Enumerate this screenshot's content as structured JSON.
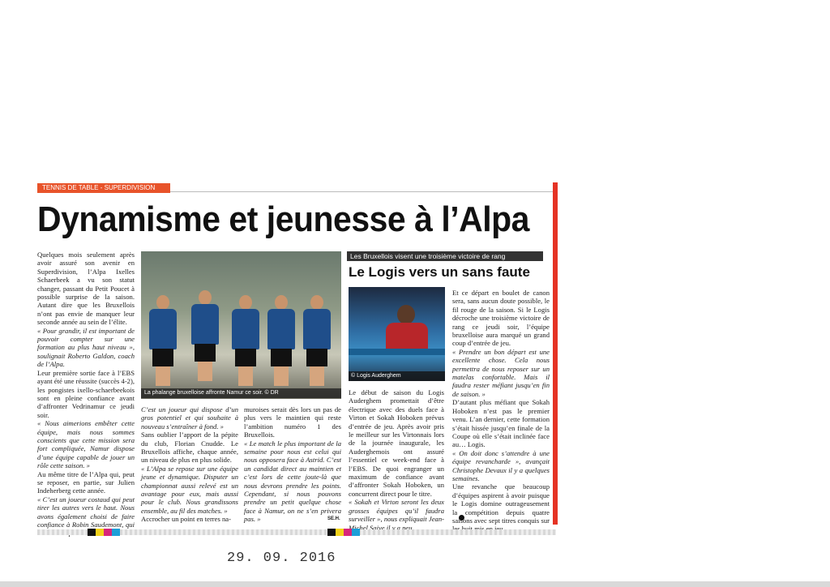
{
  "article": {
    "kicker": "TENNIS DE TABLE - SUPERDIVISION",
    "headline": "Dynamisme et jeunesse à l’Alpa",
    "col1": [
      "Quelques mois seulement après avoir assuré son avenir en Superdivision, l’Alpa Ixelles Schaerbeek a vu son statut changer, passant du Petit Poucet à possible surprise de la saison. Autant dire que les Bruxellois n’ont pas envie de manquer leur seconde année au sein de l’élite.",
      "« Pour grandir, il est important de pouvoir compter sur une formation au plus haut niveau », soulignait Roberto Galdon, coach de l’Alpa.",
      "Leur première sortie face à l’EBS ayant été une réussite (succès 4-2), les pongistes ixello-schaerbeekois sont en pleine confiance avant d’affronter Vedrinamur ce jeudi soir.",
      "« Nous aimerions embêter cette équipe, mais nous sommes conscients que cette mission sera fort compliquée, Namur dispose d’une équipe capable de jouer un rôle cette saison. »",
      "Au même titre de l’Alpa qui, peut se reposer, en partie, sur Julien Indeherberg cette année.",
      "« C’est un joueur costaud qui peut tirer les autres vers le haut. Nous avons également choisi de faire confiance à Robin Saudemont, qui retrouve le plus haut niveau."
    ],
    "col2": [
      "C’est un joueur qui dispose d’un gros potentiel et qui souhaite à nouveau s’entraîner à fond. »",
      "Sans oublier l’apport de la pépite du club, Florian Cnudde. Le Bruxellois affiche, chaque année, un niveau de plus en plus solide.",
      "« L’Alpa se repose sur une équipe jeune et dynamique. Disputer un championnat aussi relevé est un avantage pour eux, mais aussi pour le club. Nous grandissons ensemble, au fil des matches. »",
      "Accrocher un point en terres na-"
    ],
    "col3": [
      "muroises serait dès lors un pas de plus vers le maintien qui reste l’ambition numéro 1 des Bruxellois.",
      "« Le match le plus important de la semaine pour nous est celui qui nous opposera face à Astrid. C’est un candidat direct au maintien et c’est lors de cette joute-là que nous devrons prendre les points. Cependant, si nous pouvons prendre un petit quelque chose face à Namur, on ne s’en privera pas. »"
    ],
    "signature": "SE.H.",
    "photo_caption": "La phalange bruxelloise affronte Namur ce soir. © DR"
  },
  "sidebar": {
    "kicker": "Les Bruxellois visent une troisième victoire de rang",
    "headline": "Le Logis vers un sans faute",
    "photo_caption": "© Logis Auderghem",
    "col1": [
      "Le début de saison du Logis Auderghem promettait d’être électrique avec des duels face à Virton et Sokah Hoboken prévus d’entrée de jeu. Après avoir pris le meilleur sur les Virtonnais lors de la journée inaugurale, les Auderghemois ont assuré l’essentiel ce week-end face à l’EBS. De quoi engranger un maximum de confiance avant d’affronter Sokah Hoboken, un concurrent direct pour le titre.",
      "« Sokah et Virton seront les deux grosses équipes qu’il faudra surveiller », nous expliquait Jean-Michel Saive il y a peu."
    ],
    "col2": [
      "Et ce départ en boulet de canon sera, sans aucun doute possible, le fil rouge de la saison. Si le Logis décroche une troisième victoire de rang ce jeudi soir, l’équipe bruxelloise aura marqué un grand coup d’entrée de jeu.",
      "« Prendre un bon départ est une excellente chose. Cela nous permettra de nous reposer sur un matelas confortable. Mais il faudra rester méfiant jusqu’en fin de saison. »",
      "D’autant plus méfiant que Sokah Hoboken n’est pas le premier venu. L’an dernier, cette formation s’était hissée jusqu’en finale de la Coupe où elle s’était inclinée face au… Logis.",
      "« On doit donc s’attendre à une équipe revancharde », avançait Christophe Devaux il y a quelques semaines.",
      "Une revanche que beaucoup d’équipes aspirent à avoir puisque le Logis domine outrageusement la compétition depuis quatre saisons avec sept titres conquis sur les huit mis en jeu."
    ]
  },
  "stamp": {
    "date": "29. 09. 2016"
  },
  "colors": {
    "accent": "#e53324",
    "kicker": "#e8532a",
    "jersey": "#1f4e8a"
  }
}
